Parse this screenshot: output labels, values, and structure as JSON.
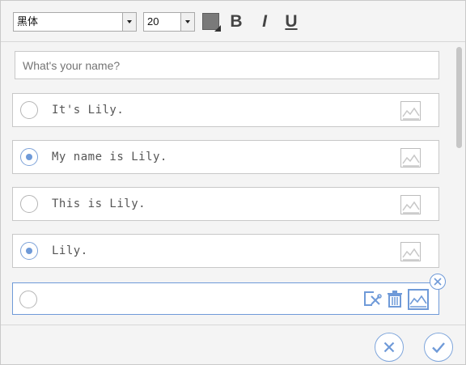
{
  "toolbar": {
    "font_family_value": "黑体",
    "font_size_value": "20",
    "bold_label": "B",
    "italic_label": "I",
    "underline_label": "U",
    "text_color": "#7a7a7a"
  },
  "question": {
    "placeholder": "What's your name?"
  },
  "options": [
    {
      "label": "It's Lily.",
      "checked": false
    },
    {
      "label": "My name is Lily.",
      "checked": true
    },
    {
      "label": "This is Lily.",
      "checked": false
    },
    {
      "label": "Lily.",
      "checked": true
    },
    {
      "label": "",
      "checked": false,
      "editing": true
    }
  ],
  "colors": {
    "accent": "#6f9ad8",
    "border": "#c8c8c8"
  }
}
